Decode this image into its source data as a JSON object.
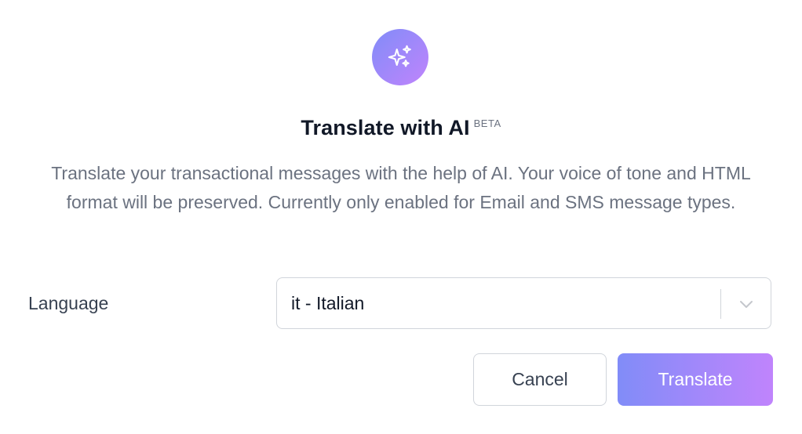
{
  "dialog": {
    "icon": "sparkles-icon",
    "title": "Translate with AI",
    "badge": "BETA",
    "description": "Translate your transactional messages with the help of AI. Your voice of tone and HTML format will be preserved. Currently only enabled for Email and SMS message types."
  },
  "language": {
    "label": "Language",
    "selected": "it - Italian",
    "chevron_icon": "chevron-down-icon"
  },
  "actions": {
    "cancel_label": "Cancel",
    "translate_label": "Translate"
  },
  "colors": {
    "gradient_start": "#818cf8",
    "gradient_end": "#c084fc",
    "text_primary": "#111827",
    "text_muted": "#6b7280",
    "border": "#d1d5db"
  }
}
